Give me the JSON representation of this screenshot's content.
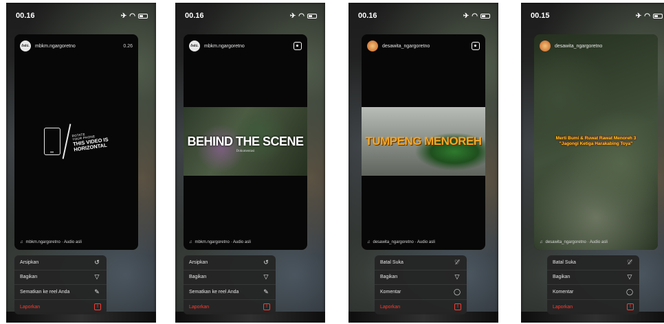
{
  "screens": [
    {
      "time": "00.16",
      "username": "mbkm.ngargoretno",
      "avatar_text": "ðalú.",
      "counter": "0.26",
      "rotate_small_1": "ROTATE",
      "rotate_small_2": "YOUR PHONE",
      "rotate_big_1": "THIS VIDEO IS",
      "rotate_big_2": "HORIZONTAL",
      "audio": "mbkm.ngargoretno · Audio asli",
      "menu": [
        "Arsipkan",
        "Bagikan",
        "Sematkan ke reel Anda",
        "Laporkan"
      ]
    },
    {
      "time": "00.16",
      "username": "mbkm.ngargoretno",
      "avatar_text": "ðalú.",
      "title": "BEHIND THE SCENE",
      "subtitle": "Dokumentasi",
      "audio": "mbkm.ngargoretno · Audio asli",
      "menu": [
        "Arsipkan",
        "Bagikan",
        "Sematkan ke reel Anda",
        "Laporkan"
      ]
    },
    {
      "time": "00.16",
      "username": "desawita_ngargoretno",
      "title": "TUMPENG MENOREH",
      "audio": "desawita_ngargoretno · Audio asli",
      "menu": [
        "Batal Suka",
        "Bagikan",
        "Komentar",
        "Laporkan"
      ]
    },
    {
      "time": "00.15",
      "username": "desawita_ngargoretno",
      "caption_1": "Merti Bumi & Ruwat Rawat Menoreh 3",
      "caption_2": "\"Jagongi Ketiga Harakabing Toya\"",
      "audio": "desawita_ngargoretno · Audio asli",
      "menu": [
        "Batal Suka",
        "Bagikan",
        "Komentar",
        "Laporkan"
      ]
    }
  ],
  "icons": {
    "archive": "history-icon",
    "share": "send-icon",
    "pin": "pin-icon",
    "report": "report-icon",
    "unlike": "heart-slash-icon",
    "comment": "comment-icon"
  },
  "colors": {
    "report": "#ff3b30",
    "menu_bg": "#242424",
    "title_orange": "#f5a623",
    "caption_yellow": "#ffd21f"
  }
}
